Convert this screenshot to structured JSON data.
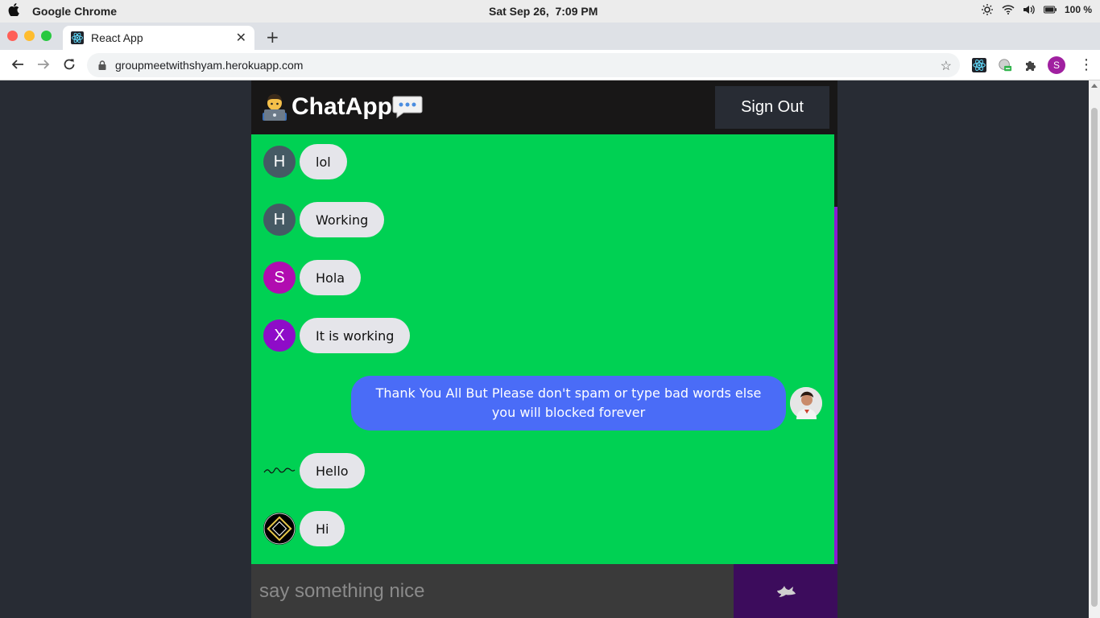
{
  "os": {
    "app_name": "Google Chrome",
    "clock": "Sat Sep 26,  7:09 PM",
    "battery": "100 %"
  },
  "browser": {
    "tab_title": "React App",
    "url": "groupmeetwithshyam.herokuapp.com",
    "profile_initial": "S",
    "icons": [
      "back-arrow-icon",
      "forward-arrow-icon",
      "reload-icon",
      "lock-icon",
      "star-icon",
      "react-devtools-icon",
      "extension-icon",
      "puzzle-icon",
      "menu-dots-icon"
    ]
  },
  "app": {
    "title": "ChatApp",
    "sign_out_label": "Sign Out",
    "composer_placeholder": "say something nice",
    "colors": {
      "header": "#181717",
      "chat_bg": "#00d153",
      "received_bubble": "#e5e5ea",
      "sent_bubble": "#4a6cf7",
      "send_button": "#3c0c5c"
    }
  },
  "messages": [
    {
      "text": "lol",
      "avatar": "H",
      "avatar_color": "#455a64",
      "type": "received"
    },
    {
      "text": "Working",
      "avatar": "H",
      "avatar_color": "#455a64",
      "type": "received"
    },
    {
      "text": "Hola",
      "avatar": "S",
      "avatar_color": "#b10cb0",
      "type": "received"
    },
    {
      "text": "It is working",
      "avatar": "X",
      "avatar_color": "#8e0cc8",
      "type": "received"
    },
    {
      "text": "Thank You All But Please don't spam or type bad words else you will blocked forever",
      "avatar": "",
      "avatar_color": "",
      "type": "sent"
    },
    {
      "text": "Hello",
      "avatar": "",
      "avatar_color": "",
      "type": "received"
    },
    {
      "text": "Hi",
      "avatar": "",
      "avatar_color": "",
      "type": "received"
    }
  ]
}
